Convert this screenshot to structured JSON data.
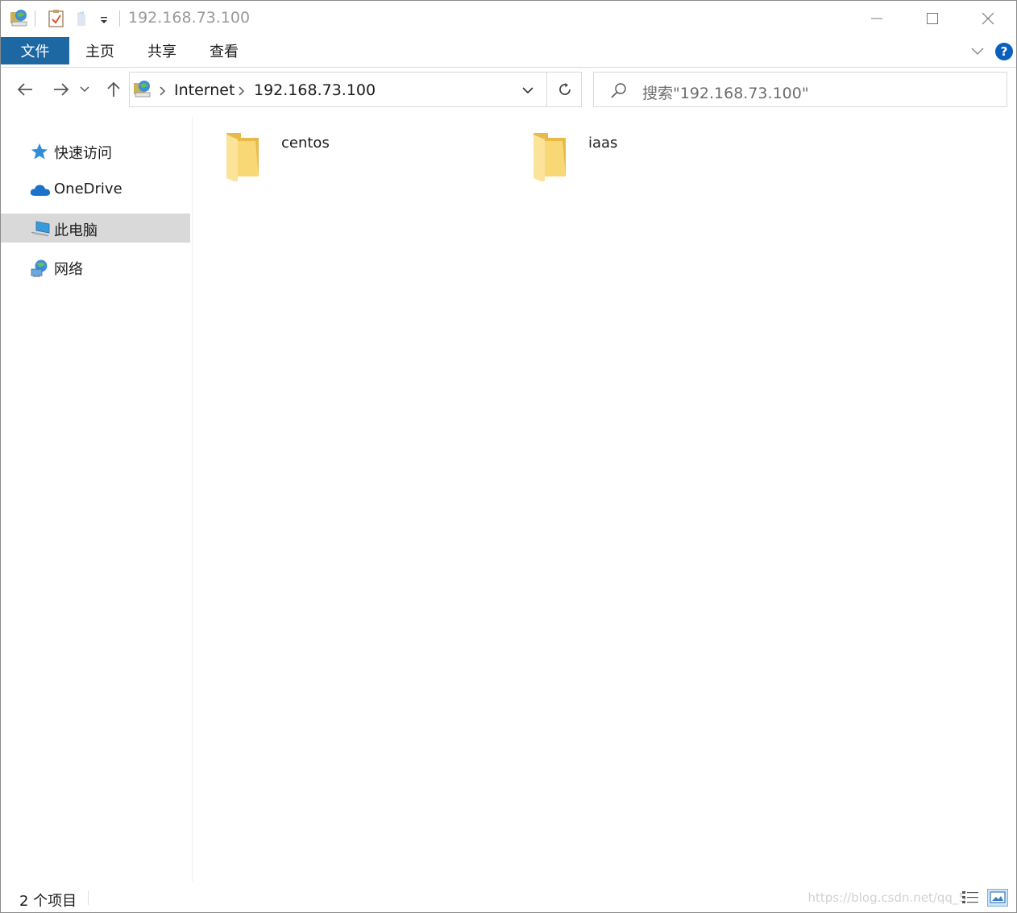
{
  "window": {
    "title": "192.168.73.100"
  },
  "ribbon": {
    "tabs": [
      {
        "label": "文件",
        "active": true
      },
      {
        "label": "主页"
      },
      {
        "label": "共享"
      },
      {
        "label": "查看"
      }
    ],
    "help_label": "?"
  },
  "address": {
    "crumbs": [
      "Internet",
      "192.168.73.100"
    ]
  },
  "search": {
    "placeholder": "搜索\"192.168.73.100\""
  },
  "nav": {
    "items": [
      {
        "label": "快速访问",
        "icon": "star-icon"
      },
      {
        "label": "OneDrive",
        "icon": "cloud-icon"
      },
      {
        "label": "此电脑",
        "icon": "computer-icon",
        "selected": true
      },
      {
        "label": "网络",
        "icon": "network-icon"
      }
    ]
  },
  "content": {
    "items": [
      {
        "name": "centos",
        "icon": "folder-icon"
      },
      {
        "name": "iaas",
        "icon": "folder-icon"
      }
    ]
  },
  "status": {
    "count": "2 个项目",
    "watermark": "https://blog.csdn.net/qq_5"
  },
  "colors": {
    "file_tab": "#1d67a3",
    "selection": "#d9d9d9",
    "folder": "#f8d775",
    "help": "#0b5fbf"
  }
}
